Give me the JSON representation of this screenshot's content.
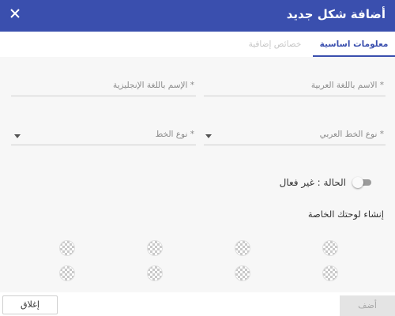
{
  "dialog": {
    "title": "أضافة شكل جديد",
    "close_icon": "close-icon"
  },
  "tabs": [
    {
      "label": "معلومات اساسية",
      "active": true
    },
    {
      "label": "خصائص إضافية",
      "active": false
    }
  ],
  "form": {
    "arabic_name_label": "الاسم باللغة العربية *",
    "english_name_label": "الإسم باللغة الإنجليزية *",
    "arabic_font_type_label": "نوع الخط العربي *",
    "font_type_label": "نوع الخط *",
    "status_label": "الحالة : غير فعال",
    "status_active": false,
    "create_board_title": "إنشاء لوحتك الخاصة"
  },
  "footer": {
    "close_label": "إغلاق",
    "add_label": "أضف"
  },
  "colors": {
    "primary": "#3a4fae",
    "inactive_tab": "#c7c7c7",
    "disabled_button": "#e4e4e4"
  }
}
